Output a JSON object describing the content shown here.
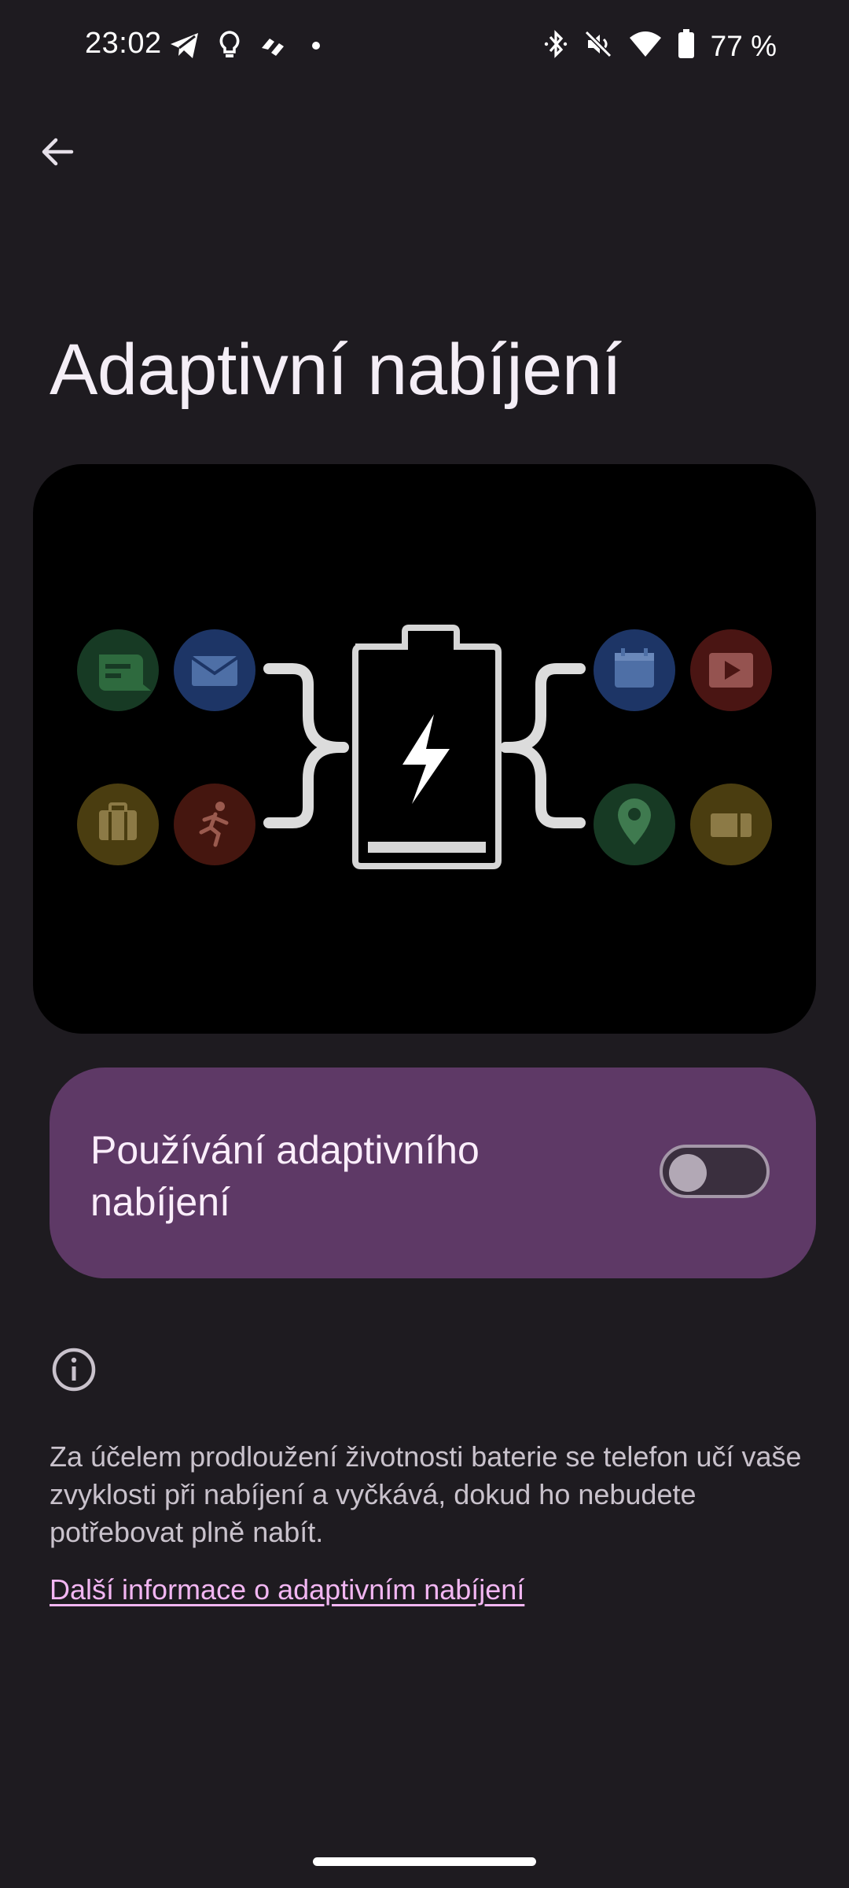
{
  "status_bar": {
    "time": "23:02",
    "battery_text": "77 %",
    "left_icons": [
      "telegram-icon",
      "lightbulb-icon",
      "app-logo-icon",
      "dot-icon"
    ],
    "right_icons": [
      "bluetooth-icon",
      "mute-icon",
      "wifi-icon",
      "battery-icon"
    ]
  },
  "header": {
    "back_icon": "arrow-back-icon",
    "title": "Adaptivní nabíjení"
  },
  "illustration": {
    "left_icons": [
      "message-icon",
      "mail-icon",
      "briefcase-icon",
      "running-icon"
    ],
    "right_icons": [
      "calendar-icon",
      "video-icon",
      "location-pin-icon",
      "ticket-icon"
    ],
    "center_icon": "battery-charging-icon"
  },
  "toggle_card": {
    "label": "Používání adaptivního nabíjení",
    "enabled": false,
    "background": "#5e3966"
  },
  "info": {
    "icon": "info-icon",
    "description": "Za účelem prodloužení životnosti baterie se telefon učí vaše zvyklosti při nabíjení a vyčkává, dokud ho nebudete potřebovat plně nabít.",
    "link": "Další informace o adaptivním nabíjení"
  },
  "colors": {
    "background": "#1e1b20",
    "link": "#f2b6f2",
    "accent_card": "#5e3966"
  }
}
